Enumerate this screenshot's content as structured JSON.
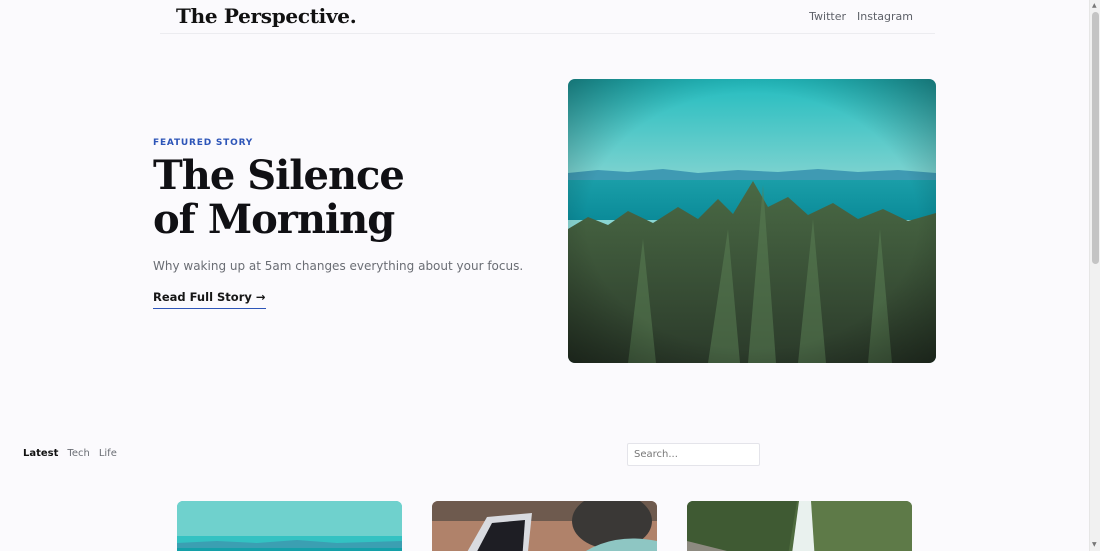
{
  "header": {
    "logo": "The Perspective.",
    "nav": [
      {
        "label": "Twitter"
      },
      {
        "label": "Instagram"
      }
    ]
  },
  "hero": {
    "kicker": "FEATURED STORY",
    "title": "The Silence of Morning",
    "subtitle": "Why waking up at 5am changes everything about your focus.",
    "cta": "Read Full Story →"
  },
  "filters": [
    {
      "label": "Latest",
      "active": true
    },
    {
      "label": "Tech",
      "active": false
    },
    {
      "label": "Life",
      "active": false
    }
  ],
  "search": {
    "placeholder": "Search...",
    "value": ""
  },
  "colors": {
    "accent": "#2d55b8",
    "background": "#fbfafd"
  }
}
